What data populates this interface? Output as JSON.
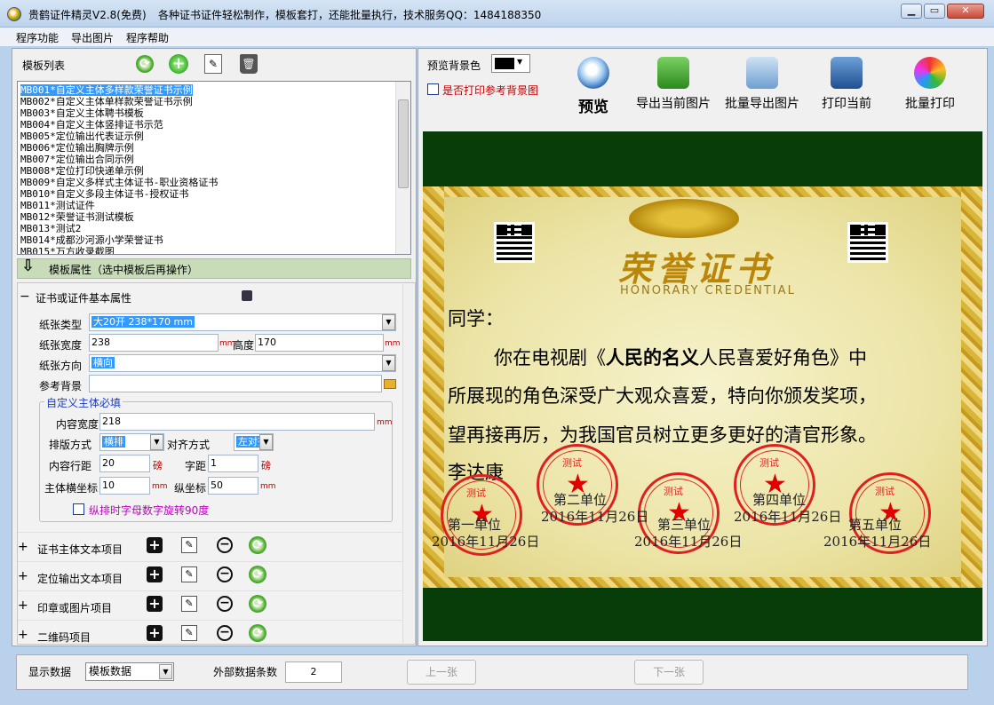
{
  "window": {
    "title": "贵鹤证件精灵V2.8(免费)",
    "subtitle": "各种证书证件轻松制作，模板套打，还能批量执行，技术服务QQ：1484188350",
    "minimize_glyph": "▁",
    "maximize_glyph": "▭",
    "close_glyph": "✕"
  },
  "menu": [
    "程序功能",
    "导出图片",
    "程序帮助"
  ],
  "templates": {
    "label": "模板列表",
    "items": [
      "MB001*自定义主体多样款荣誉证书示例",
      "MB002*自定义主体单样款荣誉证书示例",
      "MB003*自定义主体聘书模板",
      "MB004*自定义主体竖排证书示范",
      "MB005*定位输出代表证示例",
      "MB006*定位输出胸牌示例",
      "MB007*定位输出合同示例",
      "MB008*定位打印快递单示例",
      "MB009*自定义多样式主体证书-职业资格证书",
      "MB010*自定义多段主体证书-授权证书",
      "MB011*测试证件",
      "MB012*荣誉证书测试模板",
      "MB013*测试2",
      "MB014*成都沙河源小学荣誉证书",
      "MB015*万方收录截图"
    ],
    "selected_index": 0
  },
  "props": {
    "header": "模板属性（选中模板后再操作）",
    "arrow_glyph": "⇩",
    "group_title": "证书或证件基本属性",
    "paper_type_label": "纸张类型",
    "paper_type_value": "大20开 238*170 mm",
    "paper_width_label": "纸张宽度",
    "paper_width_value": "238",
    "paper_height_label": "高度",
    "paper_height_value": "170",
    "orientation_label": "纸张方向",
    "orientation_value": "横向",
    "ref_bg_label": "参考背景",
    "ref_bg_value": "",
    "unit_mm": "mm",
    "unit_pound": "磅",
    "custom_title": "自定义主体必填",
    "content_width_label": "内容宽度",
    "content_width_value": "218",
    "layout_label": "排版方式",
    "layout_value": "横排",
    "align_label": "对齐方式",
    "align_value": "左对齐",
    "line_spacing_label": "内容行距",
    "line_spacing_value": "20",
    "char_spacing_label": "字距",
    "char_spacing_value": "1",
    "x_label": "主体横坐标",
    "x_value": "10",
    "y_label": "纵坐标",
    "y_value": "50",
    "rotate_label": "纵排时字母数字旋转90度"
  },
  "sections": [
    "证书主体文本项目",
    "定位输出文本项目",
    "印章或图片项目",
    "二维码项目"
  ],
  "preview": {
    "bg_label": "预览背景色",
    "bg_color": "#000000",
    "print_bg_label": "是否打印参考背景图",
    "buttons": [
      "预览",
      "导出当前图片",
      "批量导出图片",
      "打印当前",
      "批量打印"
    ]
  },
  "certificate": {
    "title": "荣誉证书",
    "subtitle": "HONORARY CREDENTIAL",
    "greeting": "同学：",
    "line1_pre": "你在电视剧《",
    "line1_bold": "人民的名义",
    "line1_post": "人民喜爱好角色》中",
    "line2": "所展现的角色深受广大观众喜爱，特向你颁发奖项，",
    "line3": "望再接再厉，为我国官员树立更多更好的清官形象。",
    "signer": "李达康",
    "units": [
      {
        "name": "第一单位",
        "date": "2016年11月26日"
      },
      {
        "name": "第二单位",
        "date": "2016年11月26日"
      },
      {
        "name": "第三单位",
        "date": "2016年11月26日"
      },
      {
        "name": "第四单位",
        "date": "2016年11月26日"
      },
      {
        "name": "第五单位",
        "date": "2016年11月26日"
      }
    ],
    "seal_texts": [
      "测试",
      "测试",
      "测试",
      "测试",
      "测试"
    ]
  },
  "bottom": {
    "show_data_label": "显示数据",
    "show_data_value": "模板数据",
    "external_count_label": "外部数据条数",
    "external_count_value": "2",
    "prev_button": "上一张",
    "next_button": "下一张"
  }
}
